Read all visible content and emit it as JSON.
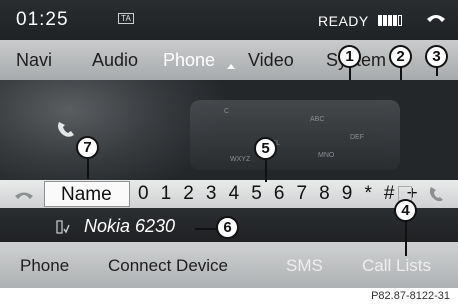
{
  "status_bar": {
    "time": "01:25",
    "ta_label": "TA",
    "status": "READY",
    "signal_bars_filled": 4,
    "signal_bars_total": 5
  },
  "main_menu": {
    "items": [
      {
        "label": "Navi",
        "active": false
      },
      {
        "label": "Audio",
        "active": false
      },
      {
        "label": "Phone",
        "active": true
      },
      {
        "label": "Video",
        "active": false
      },
      {
        "label": "System",
        "active": false
      }
    ]
  },
  "dial_line": {
    "name_button": "Name",
    "characters": "0 1 2 3 4 5 6 7 8 9 * # +"
  },
  "device": {
    "name": "Nokia 6230"
  },
  "bottom_menu": {
    "items": [
      {
        "label": "Phone",
        "enabled": true
      },
      {
        "label": "Connect Device",
        "enabled": true
      },
      {
        "label": "SMS",
        "enabled": false
      },
      {
        "label": "Call Lists",
        "enabled": false
      }
    ]
  },
  "keypad_labels": [
    "C",
    "ABC",
    "DEF",
    "JKL",
    "MNO",
    "WXYZ"
  ],
  "callouts": [
    "1",
    "2",
    "3",
    "4",
    "5",
    "6",
    "7"
  ],
  "caption": "P82.87-8122-31",
  "colors": {
    "menu_bar": "#b9bbbc",
    "screen_dark": "#1c1f22",
    "active_text": "#ffffff",
    "disabled_text": "#eeeeee"
  }
}
